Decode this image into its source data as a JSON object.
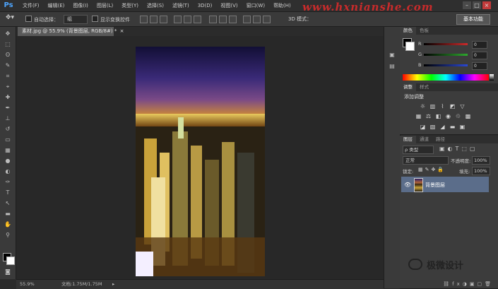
{
  "app": {
    "logo": "Ps"
  },
  "menu": [
    "文件(F)",
    "编辑(E)",
    "图像(I)",
    "图层(L)",
    "类型(Y)",
    "选择(S)",
    "滤镜(T)",
    "3D(D)",
    "视图(V)",
    "窗口(W)",
    "帮助(H)"
  ],
  "watermark_text": "www.hxnianshe.com",
  "window_controls": {
    "min": "–",
    "max": "□",
    "close": "×"
  },
  "options": {
    "auto_select_label": "自动选择：",
    "auto_select_value": "组",
    "show_transform_label": "显示变换控件",
    "mode_3d": "3D 模式：",
    "workspace": "基本功能"
  },
  "document": {
    "tab_title": "素材.jpg @ 55.9% (背景图层, RGB/8#) *",
    "close": "×"
  },
  "status": {
    "zoom": "55.9%",
    "doc_info": "文档:1.75M/1.75M"
  },
  "tools": [
    {
      "name": "move-tool-icon",
      "glyph": "✥"
    },
    {
      "name": "marquee-tool-icon",
      "glyph": "⬚"
    },
    {
      "name": "lasso-tool-icon",
      "glyph": "ʘ"
    },
    {
      "name": "quick-select-tool-icon",
      "glyph": "✎"
    },
    {
      "name": "crop-tool-icon",
      "glyph": "⌗"
    },
    {
      "name": "eyedropper-tool-icon",
      "glyph": "⌖"
    },
    {
      "name": "healing-brush-icon",
      "glyph": "✚"
    },
    {
      "name": "brush-tool-icon",
      "glyph": "✒"
    },
    {
      "name": "clone-stamp-icon",
      "glyph": "⊥"
    },
    {
      "name": "history-brush-icon",
      "glyph": "↺"
    },
    {
      "name": "eraser-tool-icon",
      "glyph": "▭"
    },
    {
      "name": "gradient-tool-icon",
      "glyph": "▦"
    },
    {
      "name": "blur-tool-icon",
      "glyph": "●"
    },
    {
      "name": "dodge-tool-icon",
      "glyph": "◐"
    },
    {
      "name": "pen-tool-icon",
      "glyph": "✑"
    },
    {
      "name": "type-tool-icon",
      "glyph": "T"
    },
    {
      "name": "path-select-icon",
      "glyph": "↖"
    },
    {
      "name": "shape-tool-icon",
      "glyph": "▬"
    },
    {
      "name": "hand-tool-icon",
      "glyph": "✋"
    },
    {
      "name": "zoom-tool-icon",
      "glyph": "⚲"
    }
  ],
  "color_panel": {
    "tabs": [
      "颜色",
      "色板"
    ],
    "channels": [
      {
        "label": "R",
        "value": "0",
        "color": "#cc2a2a"
      },
      {
        "label": "G",
        "value": "0",
        "color": "#2ea82e"
      },
      {
        "label": "B",
        "value": "0",
        "color": "#2a48d4"
      }
    ]
  },
  "adjust_panel": {
    "tabs": [
      "调整",
      "样式"
    ],
    "title": "添加调整"
  },
  "layers_panel": {
    "tabs": [
      "图层",
      "通道",
      "路径"
    ],
    "filter": "ρ 类型",
    "blend_mode": "正常",
    "opacity_label": "不透明度:",
    "opacity_value": "100%",
    "lock_label": "锁定:",
    "fill_label": "填充:",
    "fill_value": "100%",
    "layer_name": "背景图层"
  },
  "brand_watermark": "极微设计"
}
